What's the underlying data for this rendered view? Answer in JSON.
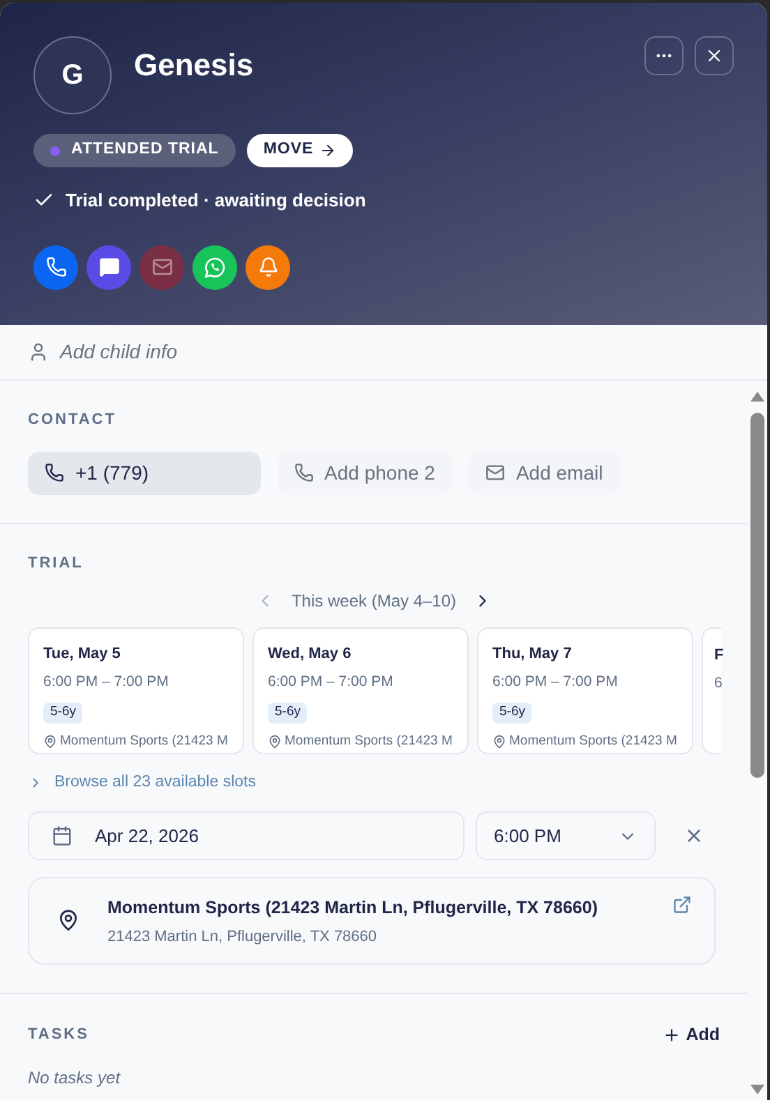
{
  "header": {
    "avatar_initial": "G",
    "name": "Genesis",
    "stage": {
      "label": "ATTENDED TRIAL",
      "color": "#8b5cf6"
    },
    "move_button": "MOVE",
    "status": "Trial completed · awaiting decision",
    "actions": [
      {
        "kind": "phone",
        "color": "#0a66f0",
        "disabled": false
      },
      {
        "kind": "message",
        "color": "#5b4be6",
        "disabled": false
      },
      {
        "kind": "email",
        "color": "#7a2f45",
        "disabled": true
      },
      {
        "kind": "whatsapp",
        "color": "#16c45a",
        "disabled": false
      },
      {
        "kind": "bell",
        "color": "#f47b0a",
        "disabled": false
      }
    ]
  },
  "child_info": {
    "placeholder": "Add child info"
  },
  "contact": {
    "heading": "CONTACT",
    "items": [
      {
        "kind": "phone",
        "label": "+1 (779)",
        "filled": true
      },
      {
        "kind": "phone",
        "label": "Add phone 2",
        "filled": false
      },
      {
        "kind": "email",
        "label": "Add email",
        "filled": false
      }
    ]
  },
  "trial": {
    "heading": "TRIAL",
    "week": "This week (May 4–10)",
    "slots": [
      {
        "day": "Tue, May 5",
        "time": "6:00 PM – 7:00 PM",
        "age": "5-6y",
        "location": "Momentum Sports (21423 M"
      },
      {
        "day": "Wed, May 6",
        "time": "6:00 PM – 7:00 PM",
        "age": "5-6y",
        "location": "Momentum Sports (21423 M"
      },
      {
        "day": "Thu, May 7",
        "time": "6:00 PM – 7:00 PM",
        "age": "5-6y",
        "location": "Momentum Sports (21423 M"
      },
      {
        "day": "F",
        "time": "6",
        "partial": true
      }
    ],
    "browse": "Browse all 23 available slots",
    "date": "Apr 22, 2026",
    "time": "6:00 PM",
    "venue": {
      "name": "Momentum Sports (21423 Martin Ln, Pflugerville, TX 78660)",
      "address": "21423 Martin Ln, Pflugerville, TX 78660"
    }
  },
  "tasks": {
    "heading": "TASKS",
    "add": "Add",
    "empty": "No tasks yet"
  }
}
